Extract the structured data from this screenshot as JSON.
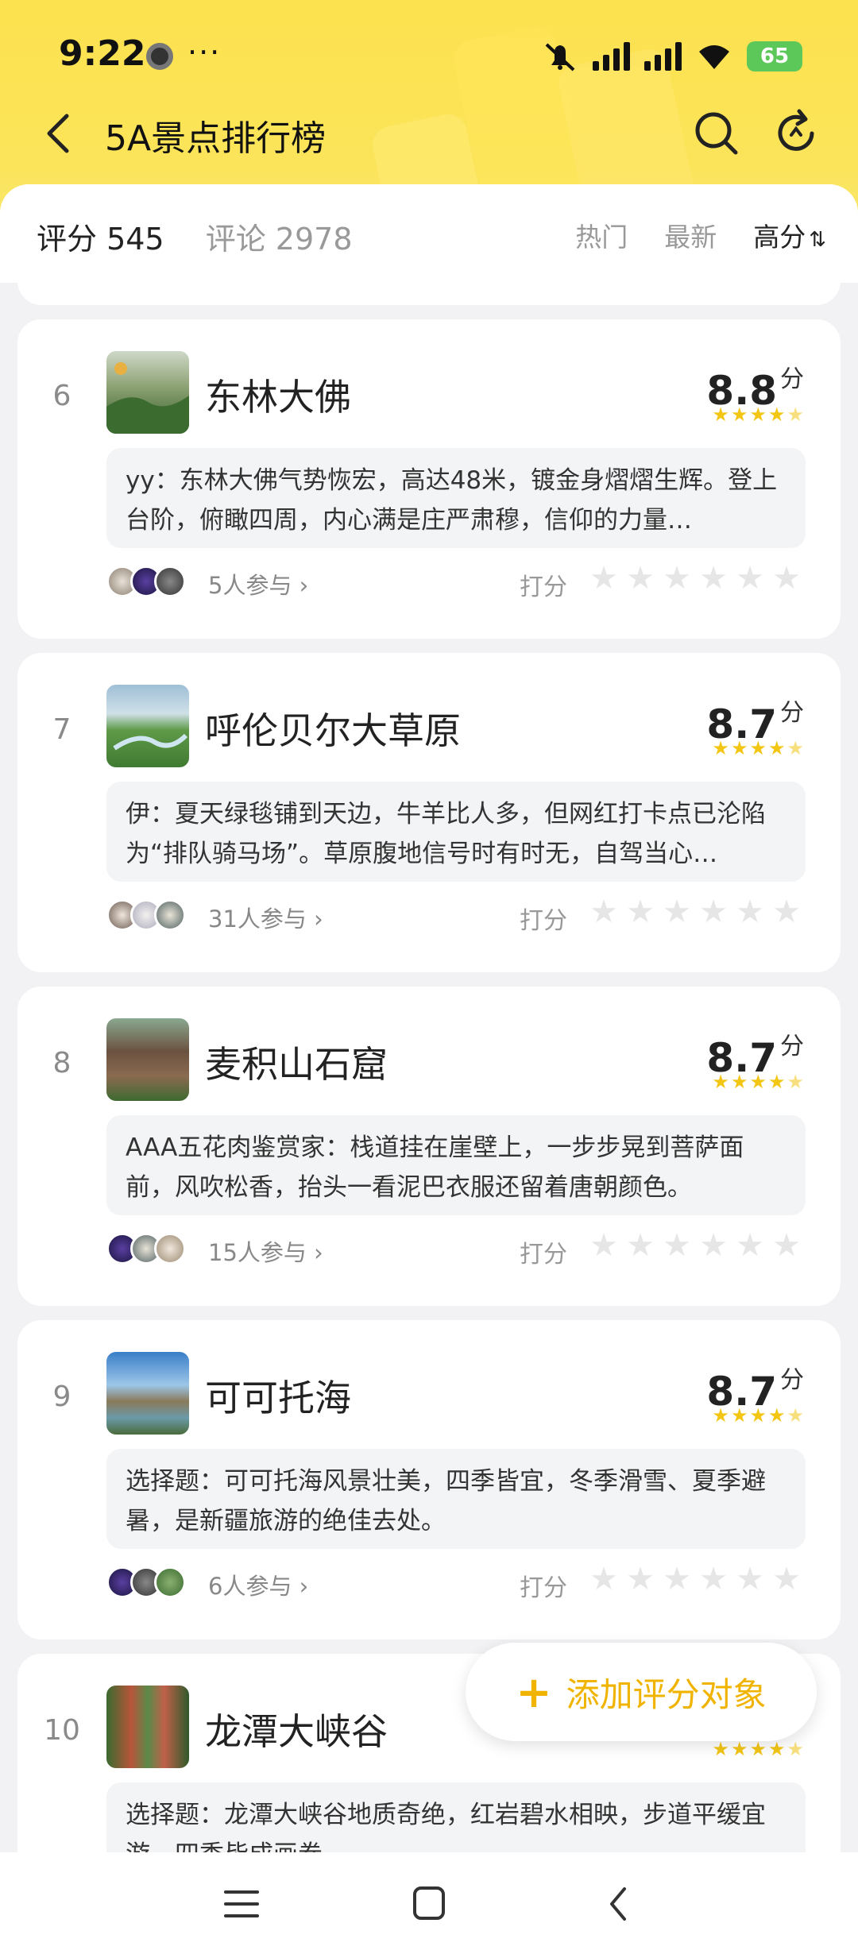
{
  "status": {
    "time": "9:22",
    "dots": "···",
    "battery": "65"
  },
  "header": {
    "title": "5A景点排行榜"
  },
  "sortbar": {
    "rating_label": "评分 545",
    "comment_label": "评论 2978",
    "options": [
      "热门",
      "最新",
      "高分"
    ],
    "active_arrow": "⇅"
  },
  "items": [
    {
      "rank": "6",
      "name": "东林大佛",
      "score": "8.8",
      "unit": "分",
      "comment": "yy：东林大佛气势恢宏，高达48米，镀金身熠熠生辉。登上台阶，俯瞰四周，内心满是庄严肃穆，信仰的力量…",
      "participants": "5人参与 ›",
      "rate_label": "打分",
      "star_rating": 4.5
    },
    {
      "rank": "7",
      "name": "呼伦贝尔大草原",
      "score": "8.7",
      "unit": "分",
      "comment": "伊：夏天绿毯铺到天边，牛羊比人多，但网红打卡点已沦陷为“排队骑马场”。草原腹地信号时有时无，自驾当心…",
      "participants": "31人参与 ›",
      "rate_label": "打分",
      "star_rating": 4.5
    },
    {
      "rank": "8",
      "name": "麦积山石窟",
      "score": "8.7",
      "unit": "分",
      "comment": "AAA五花肉鉴赏家：栈道挂在崖壁上，一步步晃到菩萨面前，风吹松香，抬头一看泥巴衣服还留着唐朝颜色。",
      "participants": "15人参与 ›",
      "rate_label": "打分",
      "star_rating": 4.5
    },
    {
      "rank": "9",
      "name": "可可托海",
      "score": "8.7",
      "unit": "分",
      "comment": "选择题：可可托海风景壮美，四季皆宜，冬季滑雪、夏季避暑，是新疆旅游的绝佳去处。",
      "participants": "6人参与 ›",
      "rate_label": "打分",
      "star_rating": 4.5
    },
    {
      "rank": "10",
      "name": "龙潭大峡谷",
      "score": "",
      "unit": "",
      "comment": "选择题：龙潭大峡谷地质奇绝，红岩碧水相映，步道平缓宜游，四季皆成画卷。",
      "participants": "",
      "rate_label": "",
      "star_rating": 4.5
    }
  ],
  "fab": {
    "plus": "+",
    "label": "添加评分对象"
  },
  "colors": {
    "header_yellow": "#fde24f",
    "star": "#f3c614",
    "accent": "#f0b400"
  }
}
